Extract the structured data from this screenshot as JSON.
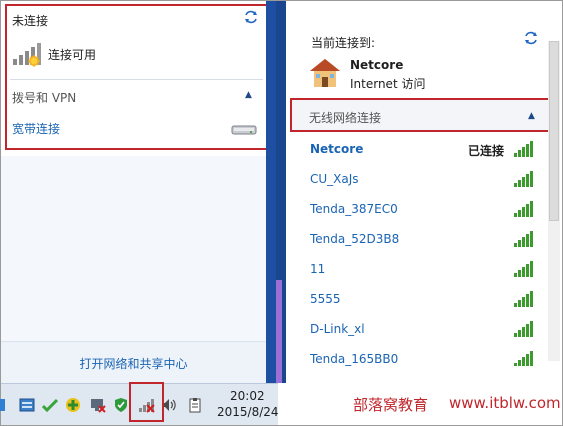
{
  "left_panel": {
    "title": "未连接",
    "connection_label": "连接可用",
    "section_title": "拨号和 VPN",
    "broadband_label": "宽带连接",
    "open_center_link": "打开网络和共享中心"
  },
  "right_panel": {
    "current_label": "当前连接到:",
    "network_name": "Netcore",
    "network_access": "Internet 访问",
    "wireless_section": "无线网络连接",
    "networks": [
      {
        "name": "Netcore",
        "status": "已连接",
        "bold": true
      },
      {
        "name": "CU_XaJs",
        "status": ""
      },
      {
        "name": "Tenda_387EC0",
        "status": ""
      },
      {
        "name": "Tenda_52D3B8",
        "status": ""
      },
      {
        "name": "11",
        "status": ""
      },
      {
        "name": "5555",
        "status": ""
      },
      {
        "name": "D-Link_xl",
        "status": ""
      },
      {
        "name": "Tenda_165BB0",
        "status": ""
      }
    ]
  },
  "taskbar": {
    "time": "20:02",
    "date": "2015/8/24"
  },
  "watermark": {
    "brand": "部落窝教育",
    "url": "www.itblw.com"
  },
  "colors": {
    "accent_blue": "#1a64b4",
    "highlight_red": "#c0262c",
    "signal_green": "#3c9a2e"
  }
}
